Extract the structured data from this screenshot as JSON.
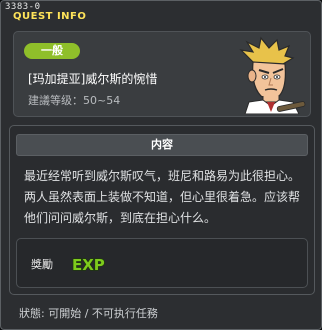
{
  "window": {
    "quest_id": "3383-0",
    "title": "QUEST INFO"
  },
  "header": {
    "badge": "一般",
    "quest_name": "[玛加提亚]威尔斯的惋惜",
    "level_text": "建議等级：50~54",
    "portrait_icon": "npc-portrait"
  },
  "description": {
    "heading": "内容",
    "text": "最近经常听到威尔斯叹气，班尼和路易为此很担心。两人虽然表面上装做不知道，但心里很着急。应该帮他们问问威尔斯，到底在担心什么。"
  },
  "reward": {
    "label": "獎勵",
    "exp_icon_text": "EXP"
  },
  "status": {
    "text": "狀態: 可開始 / 不可执行任務"
  },
  "colors": {
    "title": "#ffe45a",
    "badge": "#8fbf2a",
    "exp": "#7ecb1d"
  }
}
